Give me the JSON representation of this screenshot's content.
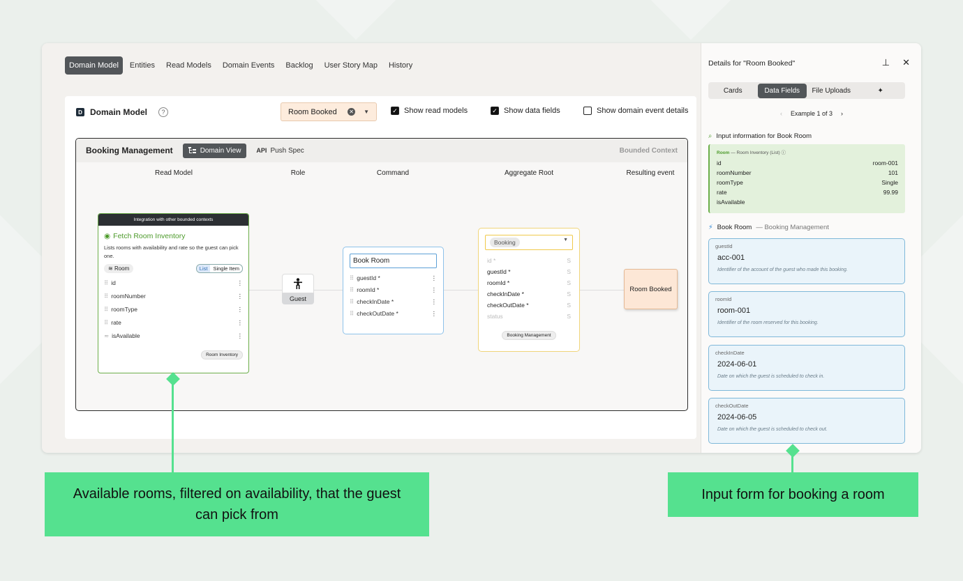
{
  "nav": [
    "Domain Model",
    "Entities",
    "Read Models",
    "Domain Events",
    "Backlog",
    "User Story Map",
    "History"
  ],
  "header": {
    "title": "Domain Model",
    "icon_letter": "D",
    "select_value": "Room Booked"
  },
  "checks": [
    {
      "label": "Show read models",
      "checked": true
    },
    {
      "label": "Show data fields",
      "checked": true
    },
    {
      "label": "Show domain event details",
      "checked": false
    }
  ],
  "context": {
    "title": "Booking Management",
    "domain_view": "Domain View",
    "api_label": "API",
    "push_spec": "Push Spec",
    "label": "Bounded Context"
  },
  "columns": [
    "Read Model",
    "Role",
    "Command",
    "Aggregate Root",
    "Resulting event"
  ],
  "read_model": {
    "banner": "Integration with other bounded contexts",
    "name": "Fetch Room Inventory",
    "description": "Lists rooms with availability and rate so the guest can pick one.",
    "entity": "Room",
    "toggle": [
      "List",
      "Single Item"
    ],
    "fields": [
      "id",
      "roomNumber",
      "roomType",
      "rate",
      "isAvailable"
    ],
    "tag": "Room Inventory"
  },
  "role": {
    "label": "Guest"
  },
  "command": {
    "name": "Book Room",
    "fields": [
      "guestId *",
      "roomId *",
      "checkInDate *",
      "checkOutDate *"
    ]
  },
  "aggregate": {
    "name": "Booking",
    "fields": [
      {
        "name": "id *",
        "type": "S",
        "dim": true
      },
      {
        "name": "guestId *",
        "type": "S",
        "dim": false
      },
      {
        "name": "roomId *",
        "type": "S",
        "dim": false
      },
      {
        "name": "checkInDate *",
        "type": "S",
        "dim": false
      },
      {
        "name": "checkOutDate *",
        "type": "S",
        "dim": false
      },
      {
        "name": "status",
        "type": "S",
        "dim": true
      }
    ],
    "tag": "Booking Management"
  },
  "event": {
    "name": "Room Booked"
  },
  "panel": {
    "title": "Details for \"Room Booked\"",
    "tabs": [
      "Cards",
      "Data Fields",
      "File Uploads"
    ],
    "example": "Example 1 of 3",
    "input_info": "Input information for Book Room",
    "room_header_name": "Room",
    "room_header_rest": "— Room Inventory  (List)",
    "room_rows": [
      {
        "k": "id",
        "v": "room-001"
      },
      {
        "k": "roomNumber",
        "v": "101"
      },
      {
        "k": "roomType",
        "v": "Single"
      },
      {
        "k": "rate",
        "v": "99.99"
      },
      {
        "k": "isAvailable",
        "v": ""
      }
    ],
    "book_section_name": "Book Room",
    "book_section_rest": "— Booking Management",
    "fields": [
      {
        "label": "guestId",
        "value": "acc-001",
        "help": "Identifier of the account of the guest who made this booking."
      },
      {
        "label": "roomId",
        "value": "room-001",
        "help": "Identifier of the room reserved for this booking."
      },
      {
        "label": "checkInDate",
        "value": "2024-06-01",
        "help": "Date on which the guest is scheduled to check in."
      },
      {
        "label": "checkOutDate",
        "value": "2024-06-05",
        "help": "Date on which the guest is scheduled to check out."
      }
    ]
  },
  "callouts": {
    "left": "Available rooms, filtered on availability, that the guest can pick from",
    "right": "Input form for booking a room"
  }
}
